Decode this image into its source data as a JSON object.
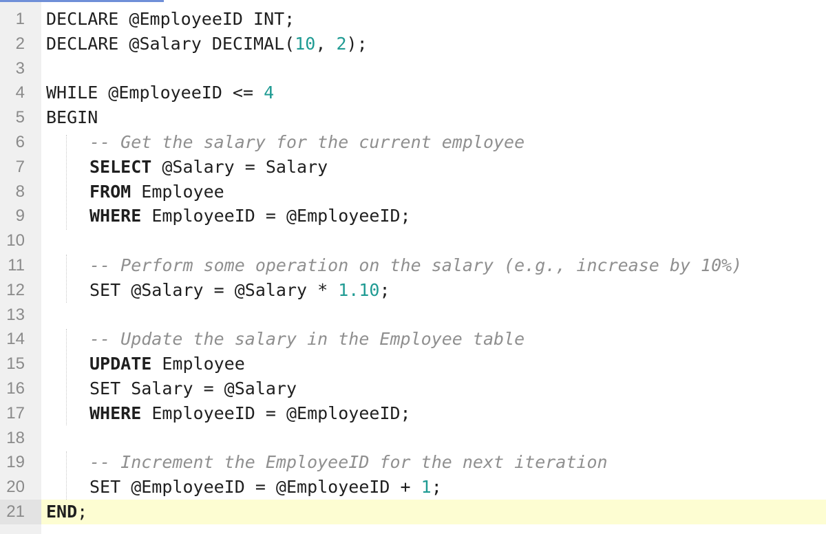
{
  "editor": {
    "lines": [
      {
        "n": "1",
        "segments": [
          {
            "t": "DECLARE @EmployeeID INT;",
            "c": "plain"
          }
        ]
      },
      {
        "n": "2",
        "segments": [
          {
            "t": "DECLARE @Salary DECIMAL(",
            "c": "plain"
          },
          {
            "t": "10",
            "c": "num"
          },
          {
            "t": ", ",
            "c": "plain"
          },
          {
            "t": "2",
            "c": "num"
          },
          {
            "t": ");",
            "c": "plain"
          }
        ]
      },
      {
        "n": "3",
        "segments": []
      },
      {
        "n": "4",
        "segments": [
          {
            "t": "WHILE @EmployeeID <= ",
            "c": "plain"
          },
          {
            "t": "4",
            "c": "num"
          }
        ]
      },
      {
        "n": "5",
        "segments": [
          {
            "t": "BEGIN",
            "c": "plain"
          }
        ]
      },
      {
        "n": "6",
        "indent": true,
        "segments": [
          {
            "t": "-- Get the salary for the current employee",
            "c": "cmt"
          }
        ]
      },
      {
        "n": "7",
        "indent": true,
        "segments": [
          {
            "t": "SELECT",
            "c": "kw"
          },
          {
            "t": " @Salary = Salary",
            "c": "plain"
          }
        ]
      },
      {
        "n": "8",
        "indent": true,
        "segments": [
          {
            "t": "FROM",
            "c": "kw"
          },
          {
            "t": " Employee",
            "c": "plain"
          }
        ]
      },
      {
        "n": "9",
        "indent": true,
        "segments": [
          {
            "t": "WHERE",
            "c": "kw"
          },
          {
            "t": " EmployeeID = @EmployeeID;",
            "c": "plain"
          }
        ]
      },
      {
        "n": "10",
        "segments": []
      },
      {
        "n": "11",
        "indent": true,
        "segments": [
          {
            "t": "-- Perform some operation on the salary (e.g., increase by 10%)",
            "c": "cmt"
          }
        ]
      },
      {
        "n": "12",
        "indent": true,
        "segments": [
          {
            "t": "SET @Salary = @Salary * ",
            "c": "plain"
          },
          {
            "t": "1.10",
            "c": "num"
          },
          {
            "t": ";",
            "c": "plain"
          }
        ]
      },
      {
        "n": "13",
        "segments": []
      },
      {
        "n": "14",
        "indent": true,
        "segments": [
          {
            "t": "-- Update the salary in the Employee table",
            "c": "cmt"
          }
        ]
      },
      {
        "n": "15",
        "indent": true,
        "segments": [
          {
            "t": "UPDATE",
            "c": "kw"
          },
          {
            "t": " Employee",
            "c": "plain"
          }
        ]
      },
      {
        "n": "16",
        "indent": true,
        "segments": [
          {
            "t": "SET Salary = @Salary",
            "c": "plain"
          }
        ]
      },
      {
        "n": "17",
        "indent": true,
        "segments": [
          {
            "t": "WHERE",
            "c": "kw"
          },
          {
            "t": " EmployeeID = @EmployeeID;",
            "c": "plain"
          }
        ]
      },
      {
        "n": "18",
        "segments": []
      },
      {
        "n": "19",
        "indent": true,
        "segments": [
          {
            "t": "-- Increment the EmployeeID for the next iteration",
            "c": "cmt"
          }
        ]
      },
      {
        "n": "20",
        "indent": true,
        "segments": [
          {
            "t": "SET @EmployeeID = @EmployeeID + ",
            "c": "plain"
          },
          {
            "t": "1",
            "c": "num"
          },
          {
            "t": ";",
            "c": "plain"
          }
        ]
      },
      {
        "n": "21",
        "current": true,
        "segments": [
          {
            "t": "END",
            "c": "kw"
          },
          {
            "t": ";",
            "c": "plain"
          }
        ]
      }
    ]
  }
}
